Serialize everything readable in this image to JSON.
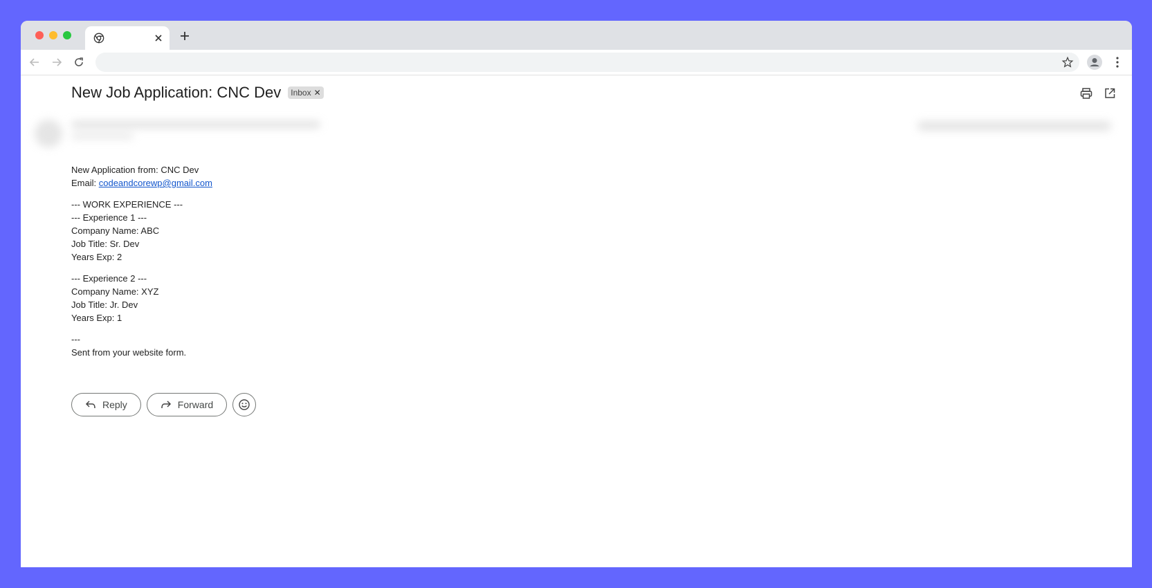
{
  "colors": {
    "background": "#6366fe",
    "link": "#1155cc",
    "traffic_red": "#fe5f57",
    "traffic_yellow": "#febc2e",
    "traffic_green": "#28c840"
  },
  "browser": {
    "tab_icon": "chrome-icon",
    "toolbar_icons": [
      "back-arrow-icon",
      "forward-arrow-icon",
      "reload-icon",
      "star-icon",
      "profile-icon",
      "more-vert-icon"
    ]
  },
  "email": {
    "subject": "New Job Application: CNC Dev",
    "label": "Inbox",
    "top_action_icons": [
      "print-icon",
      "open-in-new-window-icon"
    ],
    "body": {
      "intro": {
        "from_line": "New Application from: CNC Dev",
        "email_prefix": "Email: ",
        "email_address": "codeandcorewp@gmail.com"
      },
      "experience_1": {
        "section_heading": "--- WORK EXPERIENCE ---",
        "heading": "--- Experience 1 ---",
        "company": "Company Name: ABC",
        "job_title": "Job Title: Sr. Dev",
        "years": "Years Exp: 2"
      },
      "experience_2": {
        "heading": "--- Experience 2 ---",
        "company": "Company Name: XYZ",
        "job_title": "Job Title: Jr. Dev",
        "years": "Years Exp: 1"
      },
      "footer": {
        "separator": "---",
        "sent_line": "Sent from your website form."
      }
    },
    "actions": {
      "reply_label": "Reply",
      "forward_label": "Forward",
      "emoji_icon": "smiley-icon"
    }
  }
}
